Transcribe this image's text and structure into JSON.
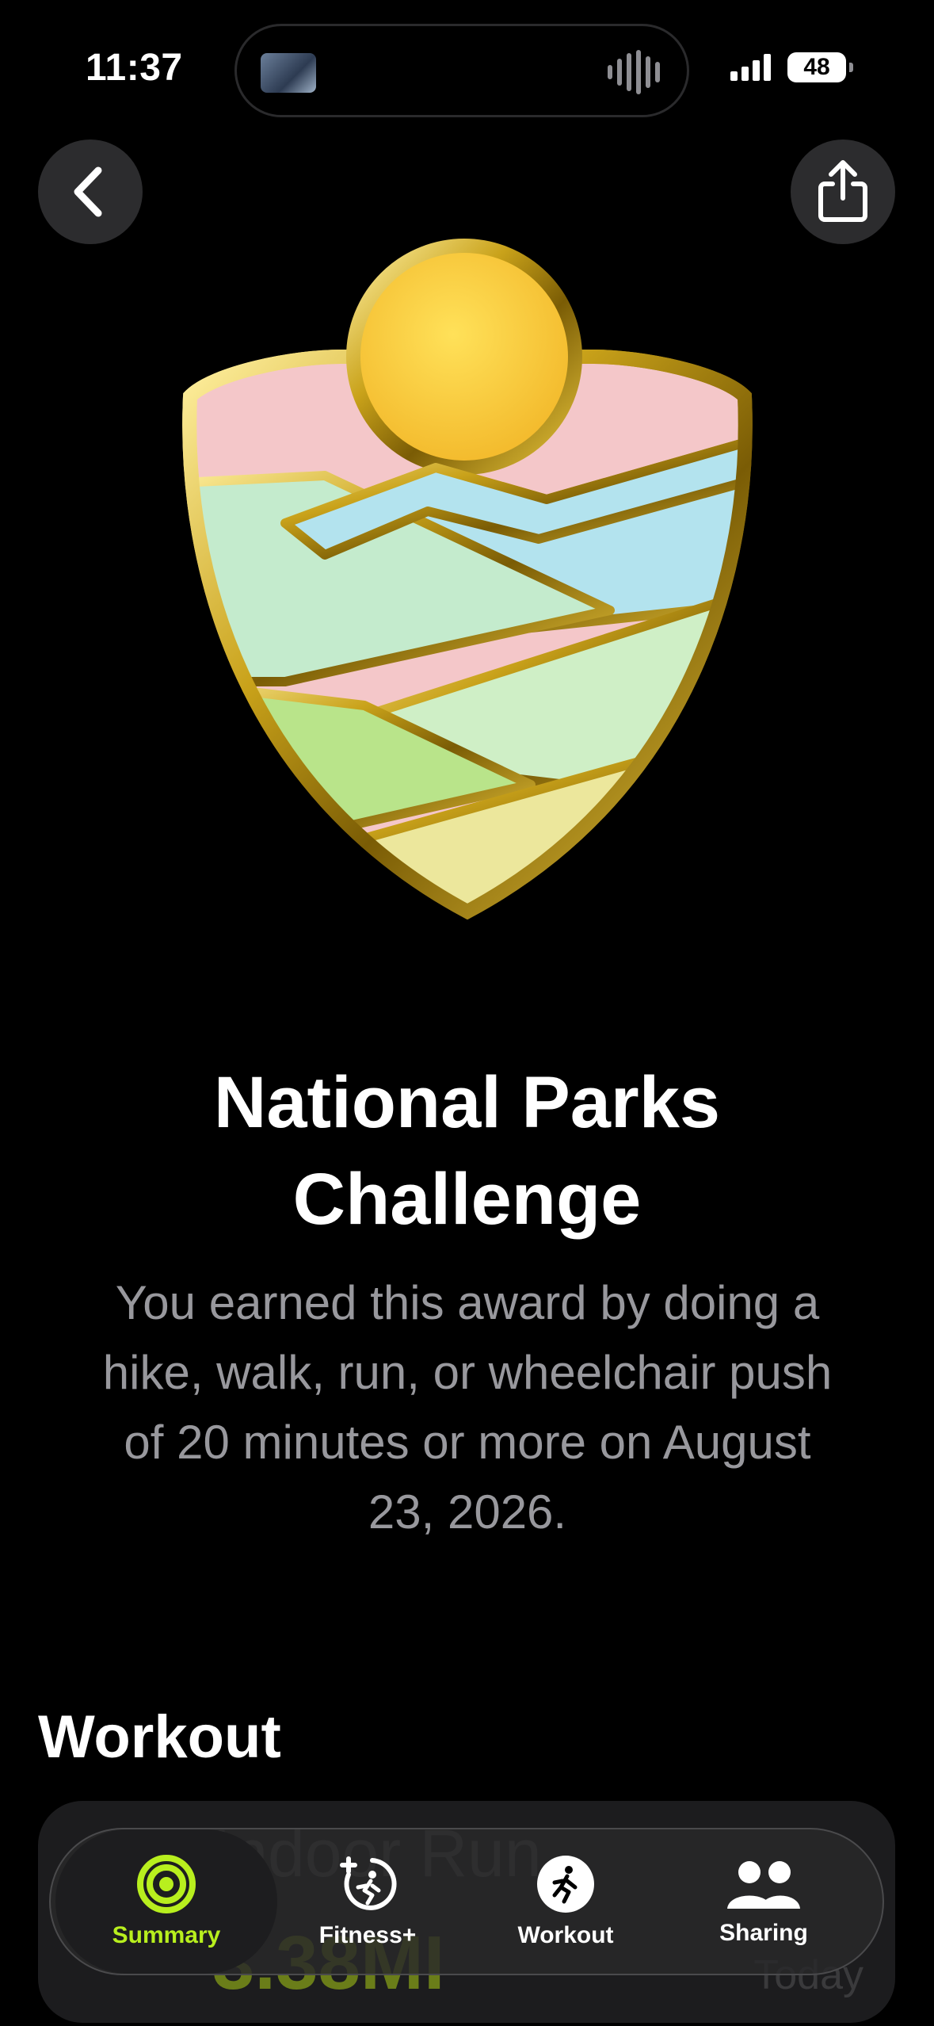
{
  "status": {
    "time": "11:37",
    "battery": "48"
  },
  "header": {
    "back_icon": "chevron-left-icon",
    "share_icon": "share-icon"
  },
  "award": {
    "title_line1": "National Parks",
    "title_line2": "Challenge",
    "description": "You earned this award by doing a hike, walk, run, or wheelchair push of 20 minutes or more on August 23, 2026."
  },
  "section": {
    "title": "Workout"
  },
  "workout_card": {
    "name": "Indoor Run",
    "distance": "3.38MI",
    "when": "Today"
  },
  "tabs": [
    {
      "label": "Summary",
      "icon": "activity-rings-icon",
      "active": true
    },
    {
      "label": "Fitness+",
      "icon": "fitness-plus-icon",
      "active": false
    },
    {
      "label": "Workout",
      "icon": "runner-icon",
      "active": false
    },
    {
      "label": "Sharing",
      "icon": "people-icon",
      "active": false
    }
  ],
  "colors": {
    "accent": "#b8ef1e",
    "background": "#000000",
    "secondary_text": "#98989d"
  }
}
